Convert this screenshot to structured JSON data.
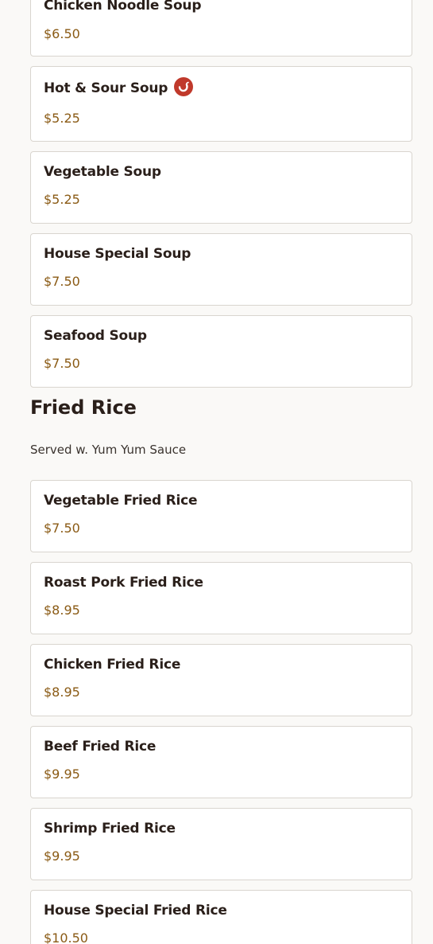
{
  "soups": [
    {
      "name": "Chicken Noodle Soup",
      "price": "$6.50"
    },
    {
      "name": "Hot & Sour Soup",
      "price": "$5.25",
      "icon": "spicy-pepper-icon",
      "icon_color": "#c0392b"
    },
    {
      "name": "Vegetable Soup",
      "price": "$5.25"
    },
    {
      "name": "House Special Soup",
      "price": "$7.50"
    },
    {
      "name": "Seafood Soup",
      "price": "$7.50"
    }
  ],
  "fried_rice": {
    "title": "Fried Rice",
    "description": "Served w. Yum Yum Sauce",
    "items": [
      {
        "name": "Vegetable Fried Rice",
        "price": "$7.50"
      },
      {
        "name": "Roast Pork Fried Rice",
        "price": "$8.95"
      },
      {
        "name": "Chicken Fried Rice",
        "price": "$8.95"
      },
      {
        "name": "Beef Fried Rice",
        "price": "$9.95"
      },
      {
        "name": "Shrimp Fried Rice",
        "price": "$9.95"
      },
      {
        "name": "House Special Fried Rice",
        "price": "$10.50"
      }
    ]
  },
  "colors": {
    "price": "#8a5a14",
    "name": "#2a1f1a",
    "spicy": "#c0392b"
  }
}
